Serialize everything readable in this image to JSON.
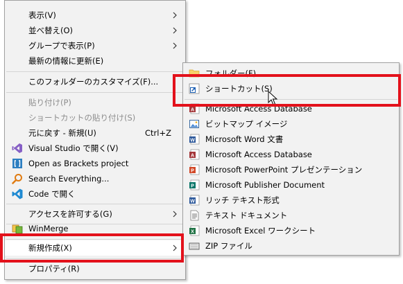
{
  "main_menu": {
    "items": [
      {
        "label": "表示(V)",
        "submenu": true,
        "icon": "",
        "disabled": false
      },
      {
        "label": "並べ替え(O)",
        "submenu": true,
        "icon": "",
        "disabled": false
      },
      {
        "label": "グループで表示(P)",
        "submenu": true,
        "icon": "",
        "disabled": false
      },
      {
        "label": "最新の情報に更新(E)",
        "submenu": false,
        "icon": "",
        "disabled": false
      },
      {
        "label": "このフォルダーのカスタマイズ(F)...",
        "submenu": false,
        "icon": "",
        "disabled": false
      },
      {
        "label": "貼り付け(P)",
        "submenu": false,
        "icon": "",
        "disabled": true
      },
      {
        "label": "ショートカットの貼り付け(S)",
        "submenu": false,
        "icon": "",
        "disabled": true
      },
      {
        "label": "元に戻す - 新規(U)",
        "shortcut": "Ctrl+Z",
        "submenu": false,
        "icon": "",
        "disabled": false
      },
      {
        "label": "Visual Studio で開く(V)",
        "submenu": false,
        "icon": "visual-studio-icon",
        "disabled": false
      },
      {
        "label": "Open as Brackets project",
        "submenu": false,
        "icon": "brackets-icon",
        "disabled": false
      },
      {
        "label": "Search Everything...",
        "submenu": false,
        "icon": "search-everything-icon",
        "disabled": false
      },
      {
        "label": "Code で開く",
        "submenu": false,
        "icon": "vscode-icon",
        "disabled": false
      },
      {
        "label": "アクセスを許可する(G)",
        "submenu": true,
        "icon": "",
        "disabled": false
      },
      {
        "label": "WinMerge",
        "submenu": false,
        "icon": "winmerge-icon",
        "disabled": false
      },
      {
        "label": "新規作成(X)",
        "submenu": true,
        "icon": "",
        "disabled": false,
        "highlighted": true
      },
      {
        "label": "プロパティ(R)",
        "submenu": false,
        "icon": "",
        "disabled": false
      }
    ]
  },
  "sub_menu": {
    "items": [
      {
        "label": "フォルダー(F)",
        "icon": "folder-icon"
      },
      {
        "label": "ショートカット(S)",
        "icon": "shortcut-icon"
      },
      {
        "label": "Microsoft Access Database",
        "icon": "access-icon"
      },
      {
        "label": "ビットマップ イメージ",
        "icon": "bitmap-icon"
      },
      {
        "label": "Microsoft Word 文書",
        "icon": "word-icon"
      },
      {
        "label": "Microsoft Access Database",
        "icon": "access-icon"
      },
      {
        "label": "Microsoft PowerPoint プレゼンテーション",
        "icon": "powerpoint-icon"
      },
      {
        "label": "Microsoft Publisher Document",
        "icon": "publisher-icon"
      },
      {
        "label": "リッチ テキスト形式",
        "icon": "rtf-icon"
      },
      {
        "label": "テキスト ドキュメント",
        "icon": "text-icon"
      },
      {
        "label": "Microsoft Excel ワークシート",
        "icon": "excel-icon"
      },
      {
        "label": "ZIP ファイル",
        "icon": "zip-icon"
      }
    ]
  },
  "colors": {
    "menu_bg": "#f2f2f2",
    "highlight_box": "#e3111b",
    "disabled_text": "#8d8d8d"
  }
}
